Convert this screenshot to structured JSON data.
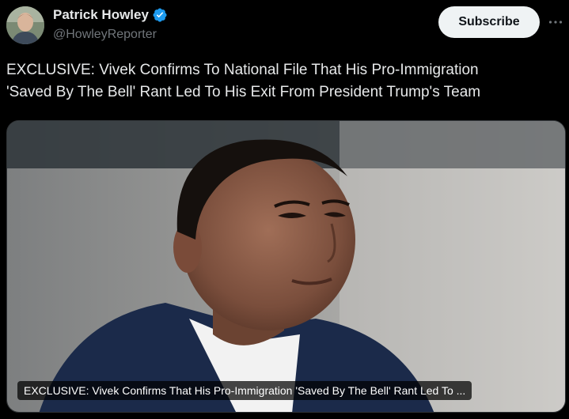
{
  "author": {
    "name": "Patrick Howley",
    "handle": "@HowleyReporter",
    "verified": true
  },
  "subscribe_label": "Subscribe",
  "more_icon": "more-horizontal-icon",
  "tweet_text": "EXCLUSIVE: Vivek Confirms To National File That His Pro-Immigration\n'Saved By The Bell' Rant Led To His Exit From President Trump's Team",
  "card": {
    "caption": "EXCLUSIVE: Vivek Confirms That His Pro-Immigration 'Saved By The Bell' Rant Led To ..."
  },
  "colors": {
    "background": "#000000",
    "text_primary": "#e7e9ea",
    "text_secondary": "#71767b",
    "verified_blue": "#1d9bf0",
    "subscribe_bg": "#eff3f4"
  }
}
